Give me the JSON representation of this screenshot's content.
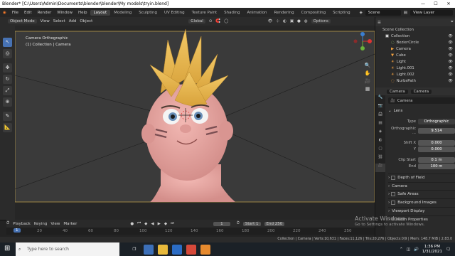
{
  "window": {
    "title": "Blender* [C:\\Users\\Admin\\Documents\\blender\\blender\\My models\\tryin.blend]",
    "controls": [
      "—",
      "☐",
      "✕"
    ]
  },
  "topbar": {
    "menus": [
      "File",
      "Edit",
      "Render",
      "Window",
      "Help"
    ],
    "workspaces": [
      "Layout",
      "Modeling",
      "Sculpting",
      "UV Editing",
      "Texture Paint",
      "Shading",
      "Animation",
      "Rendering",
      "Compositing",
      "Scripting"
    ],
    "active_workspace": "Layout",
    "scene": "Scene",
    "view_layer": "View Layer"
  },
  "toolbar": {
    "mode": "Object Mode",
    "view": "View",
    "select": "Select",
    "add": "Add",
    "object": "Object",
    "transform": "Global",
    "options": "Options"
  },
  "viewport": {
    "camera_label": "Camera Orthographic",
    "collection_label": "(1) Collection | Camera"
  },
  "outliner": {
    "scene_collection": "Scene Collection",
    "items": [
      {
        "name": "Collection",
        "icon": "collection-icon"
      },
      {
        "name": "BezierCircle",
        "icon": "curve-icon"
      },
      {
        "name": "Camera",
        "icon": "camera-icon"
      },
      {
        "name": "Cube",
        "icon": "mesh-icon"
      },
      {
        "name": "Light",
        "icon": "light-icon"
      },
      {
        "name": "Light.001",
        "icon": "light-icon"
      },
      {
        "name": "Light.002",
        "icon": "light-icon"
      },
      {
        "name": "NurbsPath",
        "icon": "curve-icon"
      }
    ]
  },
  "properties": {
    "tabs": [
      "Camera",
      "Camera"
    ],
    "data_name": "Camera",
    "lens_header": "Lens",
    "type_label": "Type",
    "type_value": "Orthographic",
    "ortho_scale_label": "Orthographic ...",
    "ortho_scale_value": "9.514",
    "shift_x_label": "Shift X",
    "shift_x_value": "0.000",
    "shift_y_label": "Y",
    "shift_y_value": "0.000",
    "clip_start_label": "Clip Start",
    "clip_start_value": "0.1 m",
    "clip_end_label": "End",
    "clip_end_value": "100 m",
    "panels": [
      "Depth of Field",
      "Camera",
      "Safe Areas",
      "Background Images",
      "Viewport Display",
      "Custom Properties"
    ]
  },
  "timeline": {
    "playback": "Playback",
    "keying": "Keying",
    "view": "View",
    "marker": "Marker",
    "current_frame": "1",
    "start_label": "Start",
    "start_value": "1",
    "end_label": "End",
    "end_value": "250",
    "ticks": [
      "1",
      "20",
      "40",
      "60",
      "80",
      "100",
      "120",
      "140",
      "160",
      "180",
      "200",
      "220",
      "240",
      "250"
    ]
  },
  "status": {
    "text": "Collection | Camera | Verts:10,631 | Faces:11,126 | Tris:20,276 | Objects:0/9 | Mem: 148.7 MiB | 2.83.0"
  },
  "watermark": {
    "line1": "Activate Windows",
    "line2": "Go to Settings to activate Windows."
  },
  "taskbar": {
    "search_placeholder": "Type here to search",
    "time": "1:36 PM",
    "date": "1/31/2021"
  },
  "colors": {
    "accent": "#4772b3",
    "skin": "#e6a3a0",
    "hair": "#e5b34f",
    "camera_frame": "#b89a4a"
  }
}
